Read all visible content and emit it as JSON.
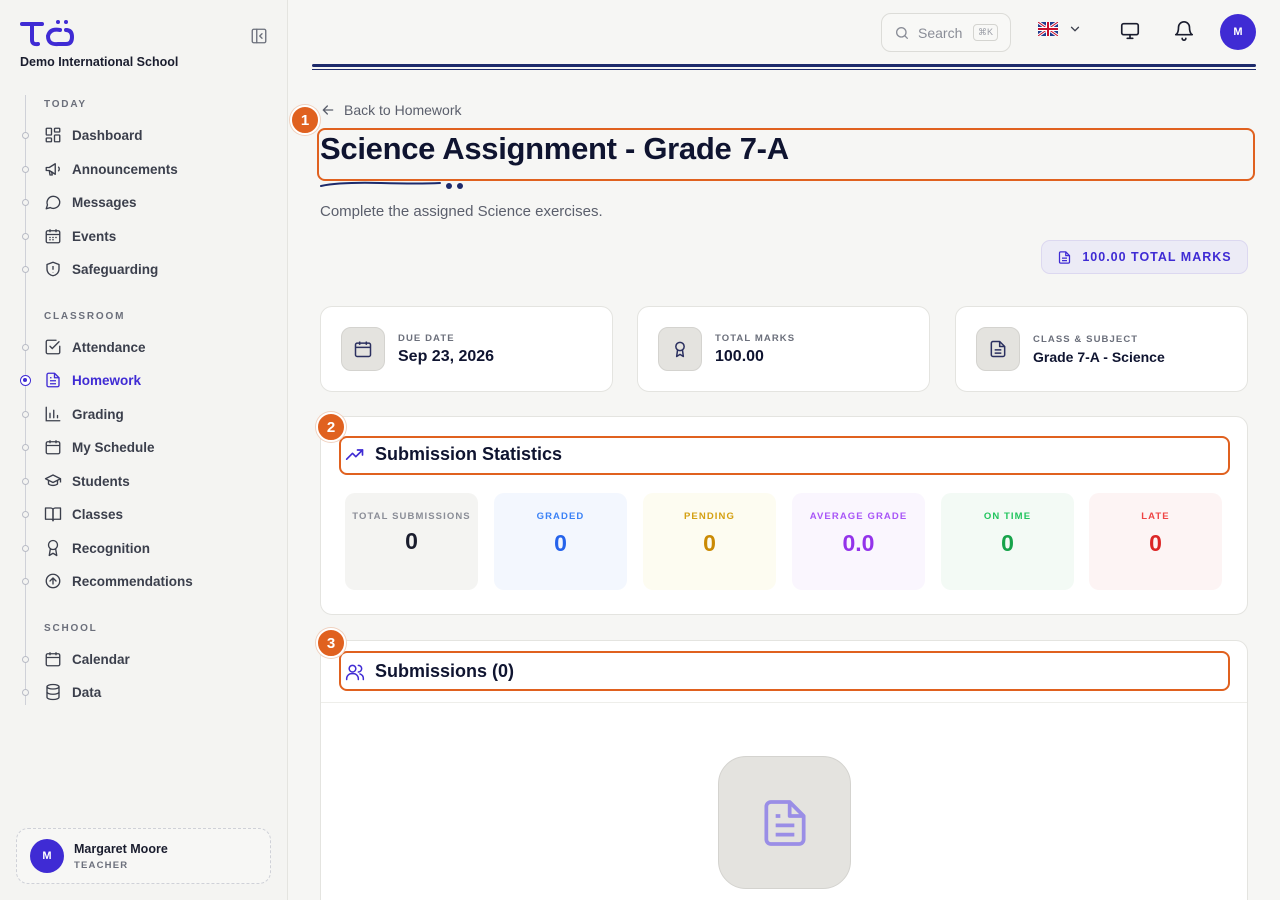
{
  "sidebar": {
    "school_name": "Demo International School",
    "sections": [
      {
        "label": "TODAY"
      },
      {
        "label": "CLASSROOM"
      },
      {
        "label": "SCHOOL"
      }
    ],
    "items": [
      {
        "label": "Dashboard",
        "icon": "dashboard-icon"
      },
      {
        "label": "Announcements",
        "icon": "megaphone-icon"
      },
      {
        "label": "Messages",
        "icon": "message-icon"
      },
      {
        "label": "Events",
        "icon": "calendar-grid-icon"
      },
      {
        "label": "Safeguarding",
        "icon": "shield-icon"
      },
      {
        "label": "Attendance",
        "icon": "check-square-icon"
      },
      {
        "label": "Homework",
        "icon": "document-icon",
        "active": true
      },
      {
        "label": "Grading",
        "icon": "bar-chart-icon"
      },
      {
        "label": "My Schedule",
        "icon": "calendar-icon"
      },
      {
        "label": "Students",
        "icon": "graduation-cap-icon"
      },
      {
        "label": "Classes",
        "icon": "book-icon"
      },
      {
        "label": "Recognition",
        "icon": "award-icon"
      },
      {
        "label": "Recommendations",
        "icon": "arrow-up-circle-icon"
      },
      {
        "label": "Calendar",
        "icon": "calendar-icon"
      },
      {
        "label": "Data",
        "icon": "database-icon"
      }
    ],
    "user": {
      "initial": "M",
      "name": "Margaret Moore",
      "role": "TEACHER"
    }
  },
  "topbar": {
    "search_placeholder": "Search",
    "search_shortcut": "⌘K",
    "avatar_initial": "M"
  },
  "page": {
    "back_label": "Back to Homework",
    "title": "Science Assignment - Grade 7-A",
    "description": "Complete the assigned Science exercises.",
    "total_marks_pill": "100.00 TOTAL MARKS",
    "info_cards": [
      {
        "label": "DUE DATE",
        "value": "Sep 23, 2026"
      },
      {
        "label": "TOTAL MARKS",
        "value": "100.00"
      },
      {
        "label": "CLASS & SUBJECT",
        "value": "Grade 7-A - Science"
      }
    ],
    "stats_title": "Submission Statistics",
    "stats": [
      {
        "label": "TOTAL SUBMISSIONS",
        "value": "0",
        "color": "#1a1d2e",
        "label_color": "#8a8d97",
        "bg": "#f4f4f2"
      },
      {
        "label": "GRADED",
        "value": "0",
        "color": "#2563eb",
        "label_color": "#3b82f6",
        "bg": "#f3f7fe"
      },
      {
        "label": "PENDING",
        "value": "0",
        "color": "#ca8a04",
        "label_color": "#d4a012",
        "bg": "#fdfcf1"
      },
      {
        "label": "AVERAGE GRADE",
        "value": "0.0",
        "color": "#9333ea",
        "label_color": "#a855f7",
        "bg": "#faf6fe"
      },
      {
        "label": "ON TIME",
        "value": "0",
        "color": "#16a34a",
        "label_color": "#22c55e",
        "bg": "#f3faf5"
      },
      {
        "label": "LATE",
        "value": "0",
        "color": "#dc2626",
        "label_color": "#ef4444",
        "bg": "#fdf4f4"
      }
    ],
    "submissions_title": "Submissions (0)"
  },
  "markers": [
    "1",
    "2",
    "3"
  ],
  "colors": {
    "accent": "#3f2bd4",
    "highlight": "#e0611f",
    "navy": "#1d2a6b"
  }
}
